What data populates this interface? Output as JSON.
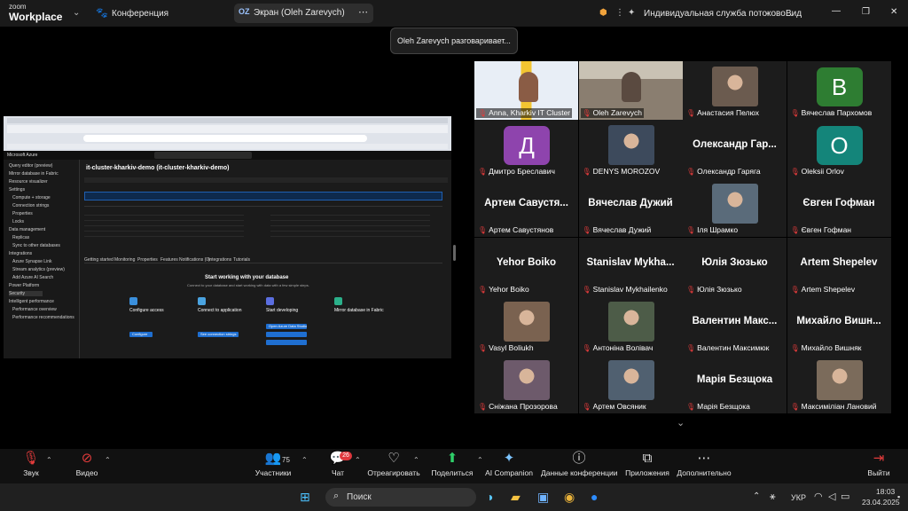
{
  "topbar": {
    "brand_small": "zoom",
    "brand": "Workplace",
    "meeting_title": "Конференция",
    "share_initials": "OZ",
    "share_label": "Экран (Oleh Zarevych)",
    "service_label": "Индивидуальная служба потоково...",
    "view_label": "Вид"
  },
  "talking_notice": "Oleh Zarevych разговаривает...",
  "shared_screen": {
    "azure_label": "Microsoft Azure",
    "resource_title": "it-cluster-kharkiv-demo (it-cluster-kharkiv-demo)",
    "heading": "Start working with your database",
    "subheading": "Connect to your database and start working with data with a few simple steps.",
    "cards": [
      {
        "title": "Configure access",
        "button": "Configure"
      },
      {
        "title": "Connect to application",
        "button": "See connection strings"
      },
      {
        "title": "Start developing",
        "button": "Open Azure Data Studio"
      },
      {
        "title": "Mirror database in Fabric",
        "button": ""
      }
    ],
    "tabs": [
      "Getting started",
      "Monitoring",
      "Properties",
      "Features",
      "Notifications (0)",
      "Integrations",
      "Tutorials"
    ],
    "sidebar_items": [
      "Query editor (preview)",
      "Mirror database in Fabric",
      "Resource visualizer",
      "Settings",
      "Compute + storage",
      "Connection strings",
      "Properties",
      "Locks",
      "Data management",
      "Replicas",
      "Sync to other databases",
      "Integrations",
      "Azure Synapse Link",
      "Stream analytics (preview)",
      "Add Azure AI Search",
      "Power Platform",
      "Security",
      "Intelligent performance",
      "Performance overview",
      "Performance recommendations"
    ]
  },
  "participants": [
    {
      "name": "Anna, Kharkiv IT Cluster",
      "kind": "video"
    },
    {
      "name": "Oleh Zarevych",
      "kind": "video",
      "active": true
    },
    {
      "name": "Анастасия Пелюх",
      "kind": "photo"
    },
    {
      "name": "Вячеслав Пархомов",
      "kind": "letter",
      "letter": "В",
      "color": "#2e7d32"
    },
    {
      "name": "Дмитро Бреславич",
      "kind": "letter",
      "letter": "Д",
      "color": "#8e44ad"
    },
    {
      "name": "DENYS MOROZOV",
      "kind": "photo"
    },
    {
      "name": "Олександр Гаряга",
      "kind": "text",
      "big": "Олександр Гар..."
    },
    {
      "name": "Oleksii Orlov",
      "kind": "letter",
      "letter": "O",
      "color": "#14857a"
    },
    {
      "name": "Артем Савустянов",
      "kind": "text",
      "big": "Артем Савустя..."
    },
    {
      "name": "Вячеслав Дужий",
      "kind": "text",
      "big": "Вячеслав Дужий"
    },
    {
      "name": "Іля Шрамко",
      "kind": "photo"
    },
    {
      "name": "Євген Гофман",
      "kind": "text",
      "big": "Євген Гофман"
    },
    {
      "name": "Yehor Boiko",
      "kind": "text",
      "big": "Yehor Boiko"
    },
    {
      "name": "Stanislav Mykhailenko",
      "kind": "text",
      "big": "Stanislav Mykha..."
    },
    {
      "name": "Юлія Зюзько",
      "kind": "text",
      "big": "Юлія Зюзько"
    },
    {
      "name": "Artem Shepelev",
      "kind": "text",
      "big": "Artem Shepelev"
    },
    {
      "name": "Vasyl Boliukh",
      "kind": "photo"
    },
    {
      "name": "Антоніна Волівач",
      "kind": "photo"
    },
    {
      "name": "Валентин Максимюк",
      "kind": "text",
      "big": "Валентин Макс..."
    },
    {
      "name": "Михайло Вишняк",
      "kind": "text",
      "big": "Михайло Вишн..."
    },
    {
      "name": "Сніжана Прозорова",
      "kind": "photo"
    },
    {
      "name": "Артем Овсяник",
      "kind": "photo"
    },
    {
      "name": "Марія Безщока",
      "kind": "text",
      "big": "Марія Безщока"
    },
    {
      "name": "Максиміліан Лановий",
      "kind": "photo"
    }
  ],
  "toolbar": {
    "audio": "Звук",
    "video": "Видео",
    "participants_count": "75",
    "participants": "Участники",
    "chat_badge": "26",
    "chat": "Чат",
    "react": "Отреагировать",
    "share": "Поделиться",
    "ai": "AI Companion",
    "meeting_data": "Данные конференции",
    "apps": "Приложения",
    "more": "Дополнительно",
    "leave": "Выйти"
  },
  "taskbar": {
    "search": "Поиск",
    "lang": "УКР",
    "time": "18:03",
    "date": "23.04.2025"
  },
  "colors": {
    "accent": "#0b5cff",
    "active_border": "#2fd06a",
    "mute_red": "#e23b3b"
  }
}
